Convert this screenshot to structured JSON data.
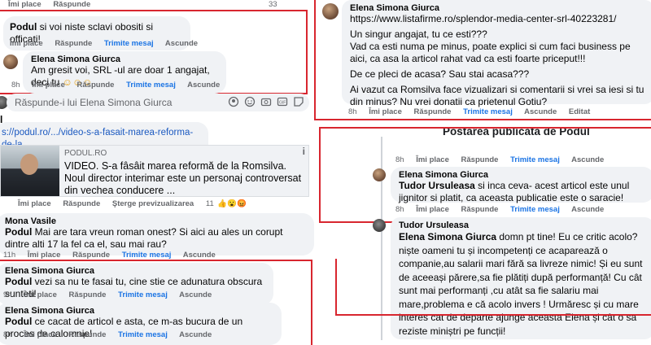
{
  "colors": {
    "highlight": "#d8262f",
    "link": "#1b59c0",
    "action_blue": "#1b74e4",
    "meta_gray": "#65676b",
    "bubble": "#f0f2f5"
  },
  "left": {
    "top_actions": {
      "like": "Îmi place",
      "reply": "Răspunde",
      "count": "33"
    },
    "c1": {
      "name": "Podul",
      "text": " si voi niste sclavi obositi si officati!"
    },
    "c1_actions": {
      "like": "Îmi place",
      "reply": "Răspunde",
      "message": "Trimite mesaj",
      "hide": "Ascunde"
    },
    "c2": {
      "name": "Elena Simona Giurca",
      "text": "Am gresit voi, SRL -ul are doar 1 angajat, deci tu"
    },
    "c2_actions": {
      "time": "8h",
      "like": "Îmi place",
      "reply": "Răspunde",
      "message": "Trimite mesaj",
      "hide": "Ascunde"
    },
    "reply_box": {
      "placeholder": "Răspunde-i lui Elena Simona Giurca"
    },
    "podul_short": "l",
    "link_text": "s://podul.ro/.../video-s-a-fasait-marea-reforma-de-la...",
    "card": {
      "source": "PODUL.RO",
      "title": "VIDEO. S-a fâsâit marea reformă de la Romsilva. Noul director interimar este un personaj controversat din vechea conducere ..."
    },
    "card_actions": {
      "like": "Îmi place",
      "reply": "Răspunde",
      "delete_preview": "Şterge previzualizarea",
      "reactions": "11"
    },
    "c3": {
      "name": "Mona Vasile",
      "text_bold": "Podul",
      "text": " Mai are tara vreun roman onest? Si aici au ales un corupt dintre alti 17 la fel ca el, sau mai rau?"
    },
    "c3_actions": {
      "time": "11h",
      "like": "Îmi place",
      "reply": "Răspunde",
      "message": "Trimite mesaj",
      "hide": "Ascunde"
    },
    "c4": {
      "name": "Elena Simona Giurca",
      "text_bold": "Podul",
      "text": " vezi sa nu te fasai tu, cine stie ce adunatura obscura sunteti!"
    },
    "c4_actions": {
      "time": "9h",
      "like": "Îmi place",
      "reply": "Răspunde",
      "message": "Trimite mesaj",
      "hide": "Ascunde"
    },
    "c5": {
      "name": "Elena Simona Giurca",
      "text_bold": "Podul",
      "text": " ce cacat de articol e asta, ce m-as bucura de un proces de calomnie!"
    },
    "c5_actions": {
      "time": "8h",
      "like": "Îmi place",
      "reply": "Răspunde",
      "message": "Trimite mesaj",
      "hide": "Ascunde"
    }
  },
  "right": {
    "c1": {
      "name": "Elena Simona Giurca",
      "url": "https://www.listafirme.ro/splendor-media-center-srl-40223281/",
      "p1": "Un singur angajat, tu ce esti???",
      "p2": "Vad ca esti numa pe minus, poate explici si cum faci business pe aici, ca asa la articol rahat vad ca esti foarte priceput!!!",
      "p3": "De ce pleci de acasa? Sau stai acasa???",
      "p4": "Ai vazut ca Romsilva face vizualizari si comentarii si vrei sa iesi si tu din minus? Nu vrei donatii ca prietenul Gotiu?"
    },
    "c1_actions": {
      "time": "8h",
      "like": "Îmi place",
      "reply": "Răspunde",
      "message": "Trimite mesaj",
      "hide": "Ascunde",
      "edited": "Editat"
    },
    "caption": "Postarea publicată de Podul",
    "a1_actions": {
      "time": "8h",
      "like": "Îmi place",
      "reply": "Răspunde",
      "message": "Trimite mesaj",
      "hide": "Ascunde"
    },
    "c2": {
      "name": "Elena Simona Giurca",
      "text_bold": "Tudor Ursuleasa",
      "text": " si inca ceva- acest articol este unul jignitor si platit, ca aceasta publicatie este o saracie!"
    },
    "a2_actions": {
      "time": "8h",
      "like": "Îmi place",
      "reply": "Răspunde",
      "message": "Trimite mesaj",
      "hide": "Ascunde"
    },
    "c3": {
      "name": "Tudor Ursuleasa",
      "text_bold": "Elena Simona Giurca",
      "text": " domn pt tine! Eu ce critic acolo? niște oameni tu și incompetenți ce acaparează o companie,au salarii mari fără sa livreze nimic! Și eu sunt de aceeași părere,sa fie plătiți după performanță! Cu cât sunt mai performanți ,cu atât sa fie salariu mai mare,problema e că acolo invers ! Urmăresc și cu mare interes cat de departe ajunge aceasta Elena și cât o sa reziste miniștri pe funcții!"
    }
  }
}
